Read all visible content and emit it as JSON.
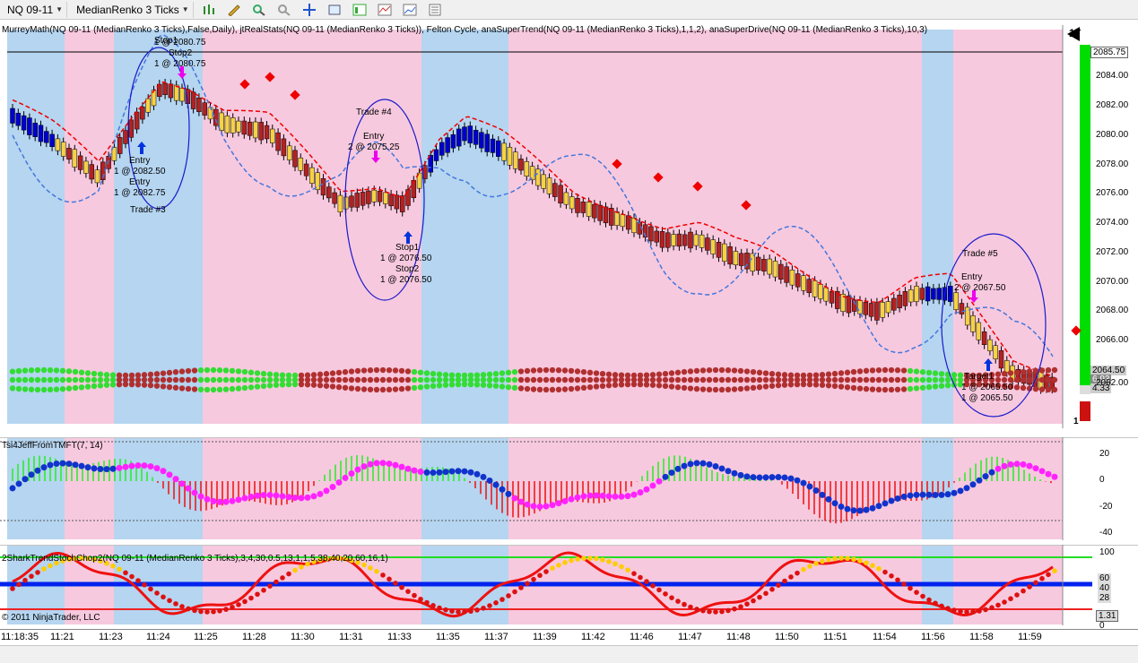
{
  "toolbar": {
    "instrument": "NQ 09-11",
    "bar_type": "MedianRenko 3 Ticks",
    "icons": [
      "bar-chart-icon",
      "pencil-icon",
      "zoom-in-icon",
      "zoom-out-icon",
      "crosshair-icon",
      "magnifier-icon",
      "properties-icon",
      "indicators-icon",
      "strategy-icon",
      "data-box-icon"
    ]
  },
  "panel1": {
    "title": "MurreyMath(NQ 09-11 (MedianRenko 3 Ticks),False,Daily), jtRealStats(NQ 09-11 (MedianRenko 3 Ticks)), Felton Cycle, anaSuperTrend(NQ 09-11 (MedianRenko 3 Ticks),1,1,2), anaSuperDrive(NQ 09-11 (MedianRenko 3 Ticks),10,3)",
    "top_right": "17",
    "bottom_right": "1",
    "current_price": "2085.75",
    "price_tag_2": "2064.50",
    "price_tag_3": "6.93",
    "price_tag_4": "4.33",
    "y_ticks": [
      "2084.00",
      "2082.00",
      "2080.00",
      "2078.00",
      "2076.00",
      "2074.00",
      "2072.00",
      "2070.00",
      "2068.00",
      "2066.00",
      "2062.00"
    ],
    "annotations": {
      "t3_stop1": "Stop1",
      "t3_stop1_px": "1 @ 2080.75",
      "t3_stop2": "Stop2",
      "t3_stop2_px": "1 @ 2080.75",
      "t3_entry1": "Entry",
      "t3_entry1_px": "1 @ 2082.50",
      "t3_entry2": "Entry",
      "t3_entry2_px": "1 @ 2082.75",
      "t3_label": "Trade #3",
      "t4_label": "Trade #4",
      "t4_entry": "Entry",
      "t4_entry_px": "2 @ 2075.25",
      "t4_stop1": "Stop1",
      "t4_stop1_px": "1 @ 2076.50",
      "t4_stop2": "Stop2",
      "t4_stop2_px": "1 @ 2076.50",
      "t5_label": "Trade #5",
      "t5_entry": "Entry",
      "t5_entry_px": "2 @ 2067.50",
      "t5_target1": "Target1",
      "t5_target1_px": "1 @ 2065.50",
      "t5_target2_px": "1 @ 2065.50"
    }
  },
  "panel2": {
    "title": "Tsi4JeffFromTMFT(7, 14)",
    "y_ticks": [
      "20",
      "0",
      "-20",
      "-40"
    ]
  },
  "panel3": {
    "title": "2SharkTrendStochChop2(NQ 09-11 (MedianRenko 3 Ticks),3,4,30,0.5,13,1,1,5,38,40,20,60,16,1)",
    "y_ticks": [
      "100",
      "0"
    ],
    "tags": [
      "60",
      "40",
      "28",
      "1.31"
    ],
    "copyright": "© 2011 NinjaTrader, LLC"
  },
  "xaxis": [
    "11:18:35",
    "11:21",
    "11:23",
    "11:24",
    "11:25",
    "11:28",
    "11:30",
    "11:31",
    "11:33",
    "11:35",
    "11:37",
    "11:39",
    "11:42",
    "11:46",
    "11:47",
    "11:48",
    "11:50",
    "11:51",
    "11:54",
    "11:56",
    "11:58",
    "11:59"
  ],
  "colors": {
    "pink": "#f7c9de",
    "blue": "#b5d5f0",
    "up": "#f5d146",
    "down": "#b22222",
    "navy": "#0000cc",
    "green": "#22dd22",
    "red": "#ee0000"
  }
}
